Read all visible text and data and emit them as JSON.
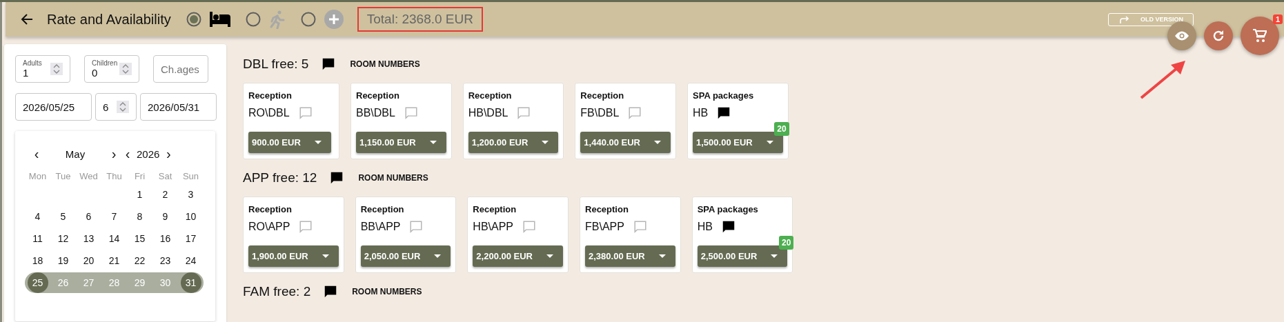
{
  "header": {
    "title": "Rate and Availability",
    "modes": [
      {
        "kind": "bed",
        "selected": true
      },
      {
        "kind": "walk",
        "selected": false
      },
      {
        "kind": "add",
        "selected": false
      }
    ],
    "total": "Total: 2368.0 EUR",
    "old_version": "OLD VERSION"
  },
  "actions": [
    {
      "kind": "view"
    },
    {
      "kind": "refresh"
    },
    {
      "kind": "cart",
      "badge": "1"
    }
  ],
  "search": {
    "adults": {
      "label": "Adults",
      "value": "1"
    },
    "children": {
      "label": "Children",
      "value": "0"
    },
    "child_ages": {
      "placeholder": "Ch.ages"
    },
    "arrival": "2026/05/25",
    "nights": "6",
    "departure": "2026/05/31"
  },
  "calendar": {
    "prev_month": "‹",
    "month": "May",
    "next_month": "›",
    "prev_year": "‹",
    "year": "2026",
    "next_year": "›",
    "weekdays": [
      "Mon",
      "Tue",
      "Wed",
      "Thu",
      "Fri",
      "Sat",
      "Sun"
    ],
    "weeks": [
      {
        "days": [
          {
            "day": "1",
            "selected": false,
            "in_range": false
          },
          {
            "day": "2",
            "selected": false,
            "in_range": false
          },
          {
            "day": "3",
            "selected": false,
            "in_range": false
          }
        ]
      },
      {
        "days": [
          {
            "day": "4",
            "selected": false,
            "in_range": false
          },
          {
            "day": "5",
            "selected": false,
            "in_range": false
          },
          {
            "day": "6",
            "selected": false,
            "in_range": false
          },
          {
            "day": "7",
            "selected": false,
            "in_range": false
          },
          {
            "day": "8",
            "selected": false,
            "in_range": false
          },
          {
            "day": "9",
            "selected": false,
            "in_range": false
          },
          {
            "day": "10",
            "selected": false,
            "in_range": false
          }
        ]
      },
      {
        "days": [
          {
            "day": "11",
            "selected": false,
            "in_range": false
          },
          {
            "day": "12",
            "selected": false,
            "in_range": false
          },
          {
            "day": "13",
            "selected": false,
            "in_range": false
          },
          {
            "day": "14",
            "selected": false,
            "in_range": false
          },
          {
            "day": "15",
            "selected": false,
            "in_range": false
          },
          {
            "day": "16",
            "selected": false,
            "in_range": false
          },
          {
            "day": "17",
            "selected": false,
            "in_range": false
          }
        ]
      },
      {
        "days": [
          {
            "day": "18",
            "selected": false,
            "in_range": false
          },
          {
            "day": "19",
            "selected": false,
            "in_range": false
          },
          {
            "day": "20",
            "selected": false,
            "in_range": false
          },
          {
            "day": "21",
            "selected": false,
            "in_range": false
          },
          {
            "day": "22",
            "selected": false,
            "in_range": false
          },
          {
            "day": "23",
            "selected": false,
            "in_range": false
          },
          {
            "day": "24",
            "selected": false,
            "in_range": false
          }
        ]
      },
      {
        "days": [
          {
            "day": "25",
            "selected": true,
            "in_range": true
          },
          {
            "day": "26",
            "selected": false,
            "in_range": true
          },
          {
            "day": "27",
            "selected": false,
            "in_range": true
          },
          {
            "day": "28",
            "selected": false,
            "in_range": true
          },
          {
            "day": "29",
            "selected": false,
            "in_range": true
          },
          {
            "day": "30",
            "selected": false,
            "in_range": true
          },
          {
            "day": "31",
            "selected": true,
            "in_range": true
          }
        ]
      }
    ]
  },
  "room_types": [
    {
      "title": "DBL free: 5",
      "has_note": true,
      "room_numbers": "ROOM NUMBERS",
      "rates": [
        {
          "source": "Reception",
          "name": "RO\\DBL",
          "has_note": false,
          "price": "900.00 EUR"
        },
        {
          "source": "Reception",
          "name": "BB\\DBL",
          "has_note": false,
          "price": "1,150.00 EUR"
        },
        {
          "source": "Reception",
          "name": "HB\\DBL",
          "has_note": false,
          "price": "1,200.00 EUR"
        },
        {
          "source": "Reception",
          "name": "FB\\DBL",
          "has_note": false,
          "price": "1,440.00 EUR"
        },
        {
          "source": "SPA packages",
          "name": "HB",
          "has_note": true,
          "price": "1,500.00 EUR",
          "badge": "20"
        }
      ]
    },
    {
      "title": "APP free: 12",
      "has_note": true,
      "room_numbers": "ROOM NUMBERS",
      "rates": [
        {
          "source": "Reception",
          "name": "RO\\APP",
          "has_note": false,
          "price": "1,900.00 EUR"
        },
        {
          "source": "Reception",
          "name": "BB\\APP",
          "has_note": false,
          "price": "2,050.00 EUR"
        },
        {
          "source": "Reception",
          "name": "HB\\APP",
          "has_note": false,
          "price": "2,200.00 EUR"
        },
        {
          "source": "Reception",
          "name": "FB\\APP",
          "has_note": false,
          "price": "2,380.00 EUR"
        },
        {
          "source": "SPA packages",
          "name": "HB",
          "has_note": true,
          "price": "2,500.00 EUR",
          "badge": "20"
        }
      ]
    },
    {
      "title": "FAM free: 2",
      "has_note": true,
      "room_numbers": "ROOM NUMBERS"
    }
  ]
}
